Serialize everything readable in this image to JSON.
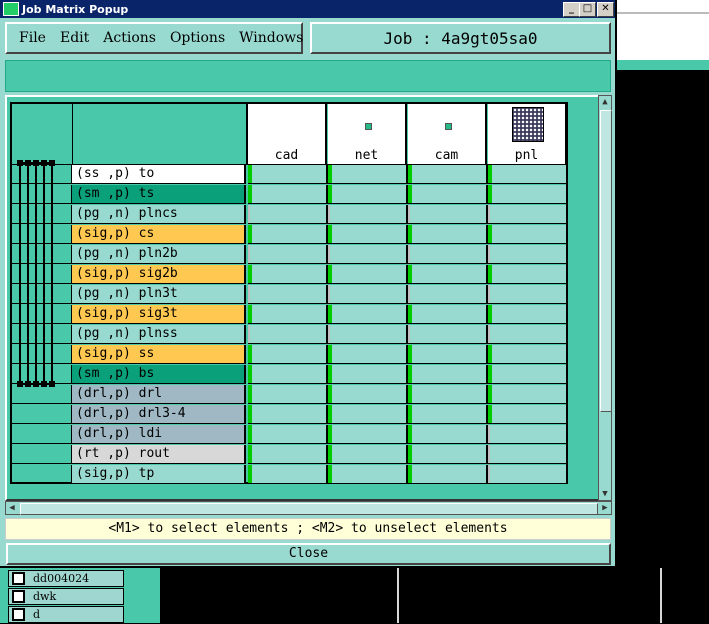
{
  "window": {
    "title": "Job Matrix Popup",
    "minimize": "_",
    "maximize": "□",
    "close": "✕"
  },
  "menu": {
    "items": [
      {
        "label": "File"
      },
      {
        "label": "Edit"
      },
      {
        "label": "Actions"
      },
      {
        "label": "Options"
      },
      {
        "label": "Windows"
      }
    ]
  },
  "job_label": "Job : 4a9gt05sa0",
  "columns": [
    "cad",
    "net",
    "cam",
    "pnl"
  ],
  "rows": [
    {
      "name": "(ss ,p) to",
      "color": "#ffffff",
      "marks": [
        true,
        true,
        true,
        true
      ]
    },
    {
      "name": "(sm ,p) ts",
      "color": "#0aa07a",
      "marks": [
        true,
        true,
        true,
        true
      ]
    },
    {
      "name": "(pg ,n) plncs",
      "color": "#99dad0",
      "marks": [
        false,
        false,
        false,
        false
      ]
    },
    {
      "name": "(sig,p) cs",
      "color": "#ffc850",
      "marks": [
        true,
        true,
        true,
        true
      ]
    },
    {
      "name": "(pg ,n) pln2b",
      "color": "#99dad0",
      "marks": [
        false,
        false,
        false,
        false
      ]
    },
    {
      "name": "(sig,p) sig2b",
      "color": "#ffc850",
      "marks": [
        true,
        true,
        true,
        true
      ]
    },
    {
      "name": "(pg ,n) pln3t",
      "color": "#99dad0",
      "marks": [
        false,
        false,
        false,
        false
      ]
    },
    {
      "name": "(sig,p) sig3t",
      "color": "#ffc850",
      "marks": [
        true,
        true,
        true,
        true
      ]
    },
    {
      "name": "(pg ,n) plnss",
      "color": "#99dad0",
      "marks": [
        false,
        false,
        false,
        false
      ]
    },
    {
      "name": "(sig,p) ss",
      "color": "#ffc850",
      "marks": [
        true,
        true,
        true,
        true
      ]
    },
    {
      "name": "(sm ,p) bs",
      "color": "#0aa07a",
      "marks": [
        true,
        true,
        true,
        true
      ]
    },
    {
      "name": "(drl,p) drl",
      "color": "#9fb8c4",
      "marks": [
        true,
        true,
        true,
        true
      ]
    },
    {
      "name": "(drl,p) drl3-4",
      "color": "#9fb8c4",
      "marks": [
        true,
        true,
        true,
        true
      ]
    },
    {
      "name": "(drl,p) ldi",
      "color": "#9fb8c4",
      "marks": [
        true,
        true,
        true,
        false
      ]
    },
    {
      "name": "(rt ,p) rout",
      "color": "#d8d8d8",
      "marks": [
        true,
        true,
        true,
        false
      ]
    },
    {
      "name": "(sig,p) tp",
      "color": "#99dad0",
      "marks": [
        true,
        true,
        true,
        false
      ]
    }
  ],
  "status_text": "<M1> to select elements ; <M2> to unselect elements",
  "close_label": "Close",
  "background_list": [
    {
      "label": "dd004024"
    },
    {
      "label": "dwk"
    },
    {
      "label": "d"
    }
  ]
}
